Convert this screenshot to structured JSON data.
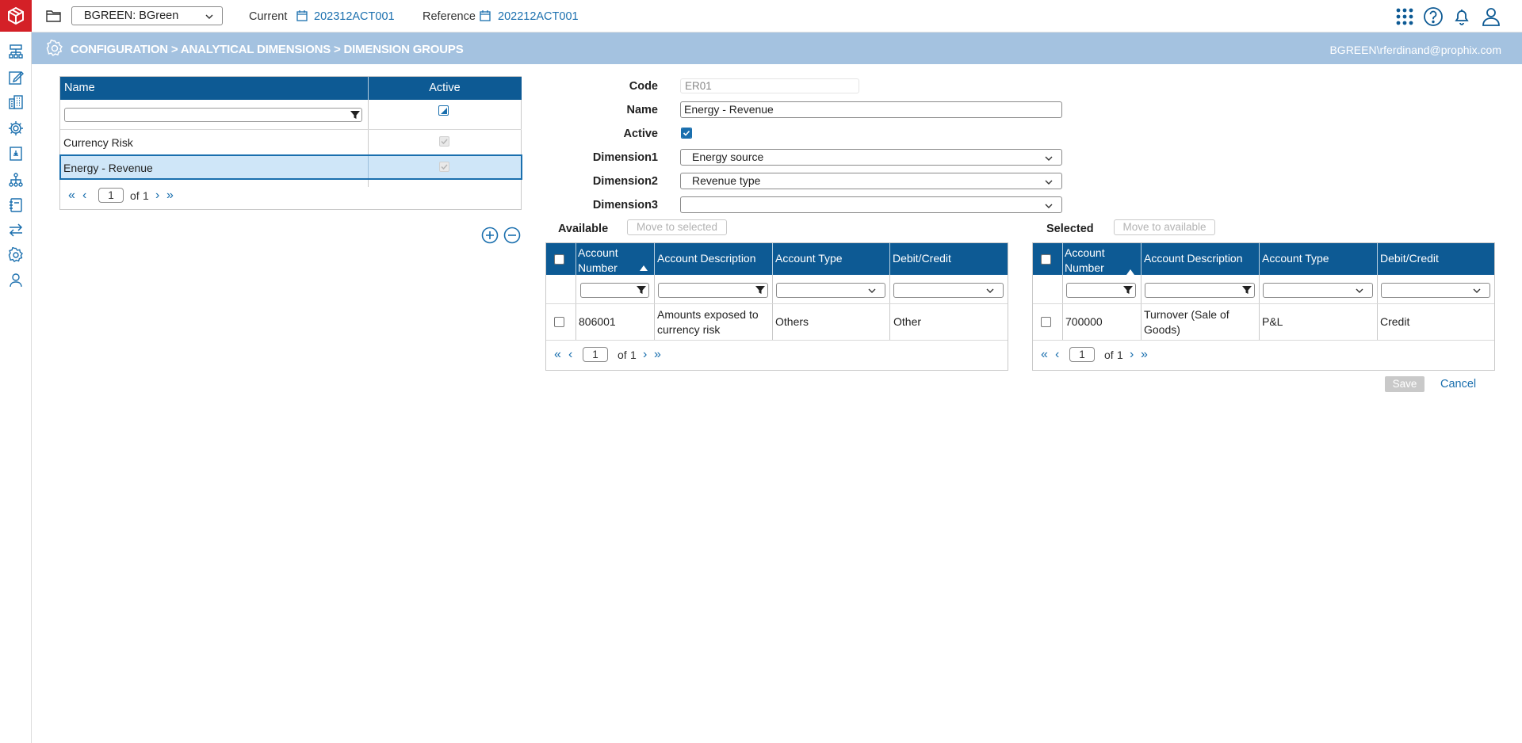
{
  "rail": {
    "icons": [
      "logo-icon",
      "org-chart-icon",
      "edit-form-icon",
      "buildings-icon",
      "gear-cog-icon",
      "report-icon",
      "hierarchy-icon",
      "notebook-icon",
      "transfer-icon",
      "settings-icon",
      "users-icon"
    ]
  },
  "topbar": {
    "entity": "BGREEN: BGreen",
    "current_label": "Current",
    "current_value": "202312ACT001",
    "reference_label": "Reference",
    "reference_value": "202212ACT001"
  },
  "band": {
    "breadcrumb": "CONFIGURATION > ANALYTICAL DIMENSIONS > DIMENSION GROUPS",
    "user": "BGREEN\\rferdinand@prophix.com"
  },
  "groups": {
    "columns": [
      "Name",
      "Active"
    ],
    "rows": [
      {
        "name": "Currency Risk",
        "active": true
      },
      {
        "name": "Energy - Revenue",
        "active": true
      }
    ],
    "pager": {
      "page": "1",
      "of": "of",
      "total": "1"
    }
  },
  "form": {
    "code_label": "Code",
    "code_value": "ER01",
    "name_label": "Name",
    "name_value": "Energy - Revenue",
    "active_label": "Active",
    "dimension1_label": "Dimension1",
    "dimension1_value": "Energy source",
    "dimension2_label": "Dimension2",
    "dimension2_value": "Revenue type",
    "dimension3_label": "Dimension3",
    "dimension3_value": ""
  },
  "available": {
    "title": "Available",
    "move_button": "Move to selected",
    "columns": [
      "Account Number",
      "Account Description",
      "Account Type",
      "Debit/Credit"
    ],
    "rows": [
      {
        "number": "806001",
        "desc_line1": "Amounts exposed to",
        "desc_line2": "currency risk",
        "type": "Others",
        "dc": "Other"
      }
    ],
    "pager": {
      "page": "1",
      "of": "of",
      "total": "1"
    }
  },
  "selected": {
    "title": "Selected",
    "move_button": "Move to available",
    "columns": [
      "Account Number",
      "Account Description",
      "Account Type",
      "Debit/Credit"
    ],
    "rows": [
      {
        "number": "700000",
        "desc_line1": "Turnover (Sale of",
        "desc_line2": "Goods)",
        "type": "P&L",
        "dc": "Credit"
      }
    ],
    "pager": {
      "page": "1",
      "of": "of",
      "total": "1"
    }
  },
  "actions": {
    "save": "Save",
    "cancel": "Cancel"
  },
  "colors": {
    "header_blue": "#0d5a94",
    "band_blue": "#a4c2e0",
    "link_blue": "#1a6fae",
    "logo_red": "#d42027",
    "selected_row": "#cfe6f8"
  }
}
